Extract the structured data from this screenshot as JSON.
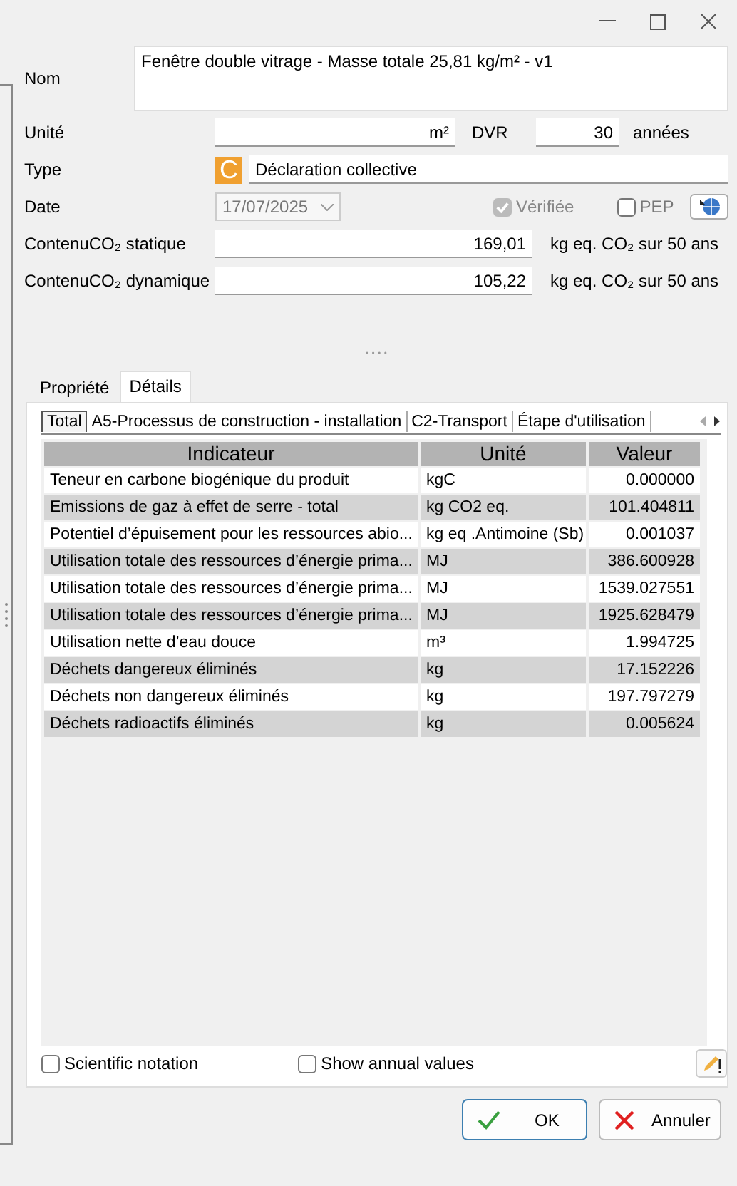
{
  "form": {
    "name_label": "Nom",
    "name_value": "Fenêtre double vitrage - Masse totale 25,81 kg/m² - v1",
    "unit_label": "Unité",
    "unit_value": "m²",
    "dvr_label": "DVR",
    "dvr_value": "30",
    "dvr_unit": "années",
    "type_label": "Type",
    "type_badge": "C",
    "type_value": "Déclaration collective",
    "date_label": "Date",
    "date_value": "17/07/2025",
    "verified": {
      "label": "Vérifiée",
      "checked": true,
      "disabled": true
    },
    "pep": {
      "label": "PEP",
      "checked": false
    },
    "co2": [
      {
        "label": "ContenuCO₂ statique",
        "value": "169,01",
        "unit": "kg eq. CO₂ sur 50 ans"
      },
      {
        "label": "ContenuCO₂ dynamique",
        "value": "105,22",
        "unit": "kg eq. CO₂ sur 50 ans"
      }
    ]
  },
  "tabs": [
    {
      "label": "Propriété",
      "selected": false
    },
    {
      "label": "Détails",
      "selected": true
    }
  ],
  "subtabs": [
    {
      "label": "Total",
      "selected": true
    },
    {
      "label": "A5-Processus de construction - installation",
      "selected": false
    },
    {
      "label": "C2-Transport",
      "selected": false
    },
    {
      "label": "Étape d'utilisation",
      "selected": false
    }
  ],
  "table": {
    "columns": [
      "Indicateur",
      "Unité",
      "Valeur"
    ],
    "rows": [
      {
        "indicator": "Teneur en carbone biogénique du produit",
        "unit": "kgC",
        "value": "0.000000"
      },
      {
        "indicator": "Emissions de gaz à effet de serre - total",
        "unit": "kg CO2 eq.",
        "value": "101.404811"
      },
      {
        "indicator": "Potentiel d’épuisement pour les ressources abio...",
        "unit": "kg eq .Antimoine (Sb)",
        "value": "0.001037"
      },
      {
        "indicator": "Utilisation totale des ressources d’énergie prima...",
        "unit": "MJ",
        "value": "386.600928"
      },
      {
        "indicator": "Utilisation totale des ressources d’énergie prima...",
        "unit": "MJ",
        "value": "1539.027551"
      },
      {
        "indicator": "Utilisation totale des ressources d’énergie prima...",
        "unit": "MJ",
        "value": "1925.628479"
      },
      {
        "indicator": "Utilisation nette d’eau douce",
        "unit": "m³",
        "value": "1.994725"
      },
      {
        "indicator": "Déchets dangereux éliminés",
        "unit": "kg",
        "value": "17.152226"
      },
      {
        "indicator": "Déchets non dangereux éliminés",
        "unit": "kg",
        "value": "197.797279"
      },
      {
        "indicator": "Déchets radioactifs éliminés",
        "unit": "kg",
        "value": "0.005624"
      }
    ]
  },
  "options": [
    {
      "label": "Scientific notation",
      "checked": false
    },
    {
      "label": "Show annual values",
      "checked": false
    }
  ],
  "buttons": [
    {
      "label": "OK",
      "kind": "ok"
    },
    {
      "label": "Annuler",
      "kind": "cancel"
    }
  ]
}
